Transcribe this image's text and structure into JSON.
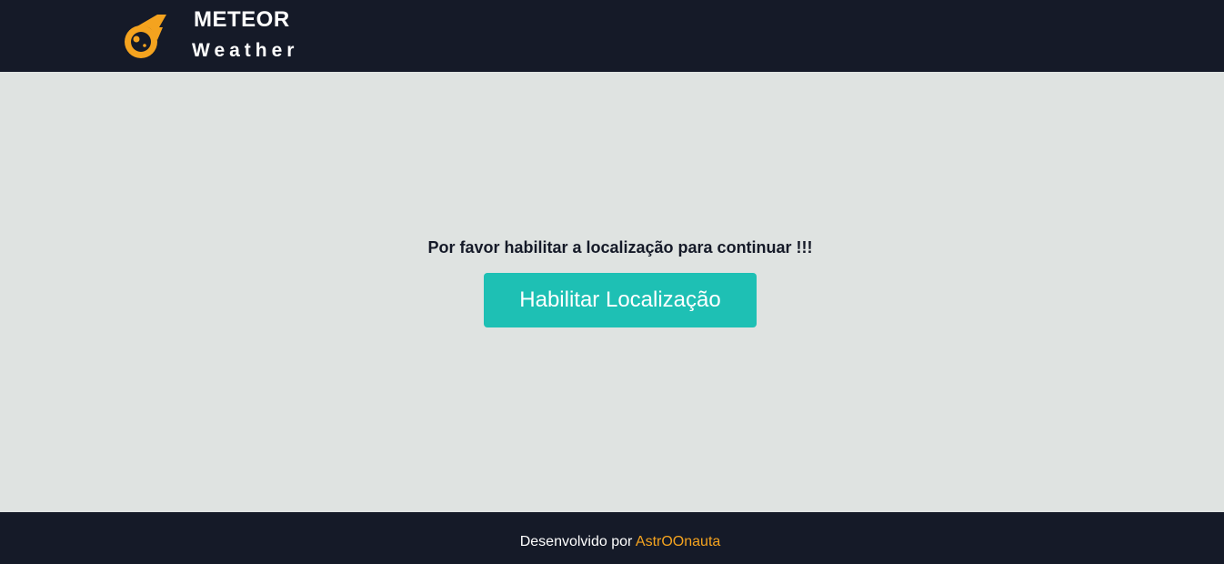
{
  "header": {
    "logo_icon": "meteor-icon",
    "brand_title": "METEOR",
    "brand_subtitle": "Weather"
  },
  "main": {
    "message": "Por favor habilitar a localização para continuar !!!",
    "enable_button_label": "Habilitar Localização"
  },
  "footer": {
    "prefix": "Desenvolvido por",
    "author_link": "AstrOOnauta"
  },
  "colors": {
    "header_bg": "#151a28",
    "page_bg": "#dfe3e1",
    "accent_orange": "#f4a31f",
    "button_teal": "#1ec0b4"
  }
}
